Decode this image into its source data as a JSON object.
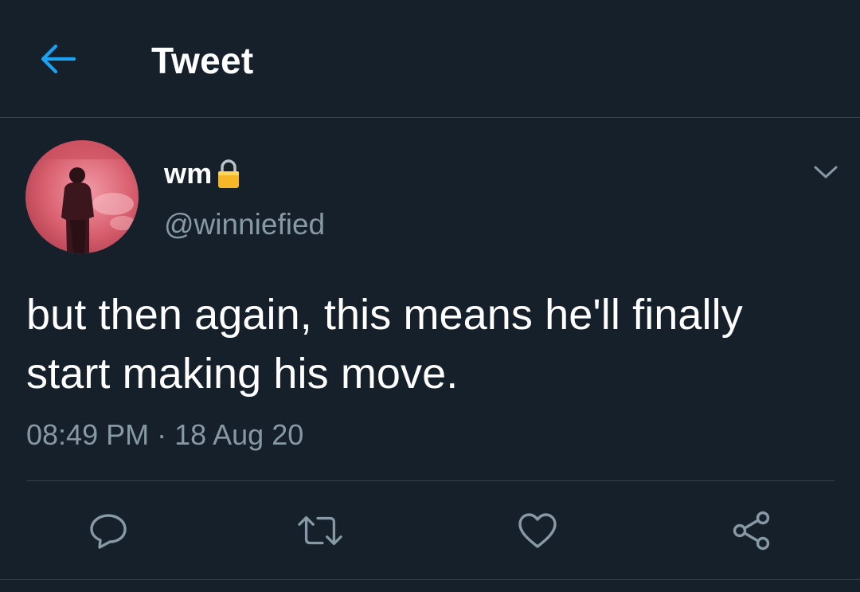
{
  "header": {
    "title": "Tweet",
    "back_icon": "arrow-left-icon"
  },
  "author": {
    "display_name": "wm",
    "protected_icon": "lock-icon",
    "handle": "@winniefied",
    "avatar": "avatar-image"
  },
  "tweet": {
    "text": "but then again, this means he'll finally\nstart making his move.",
    "time": "08:49 PM",
    "separator": "·",
    "date": "18 Aug 20"
  },
  "actions": {
    "reply_icon": "reply-icon",
    "retweet_icon": "retweet-icon",
    "like_icon": "heart-icon",
    "share_icon": "share-icon",
    "more_icon": "chevron-down-icon"
  },
  "colors": {
    "background": "#15202b",
    "accent": "#1da1f2",
    "secondary_text": "#8899a6",
    "divider": "#38444d",
    "lock": "#f5b727"
  }
}
